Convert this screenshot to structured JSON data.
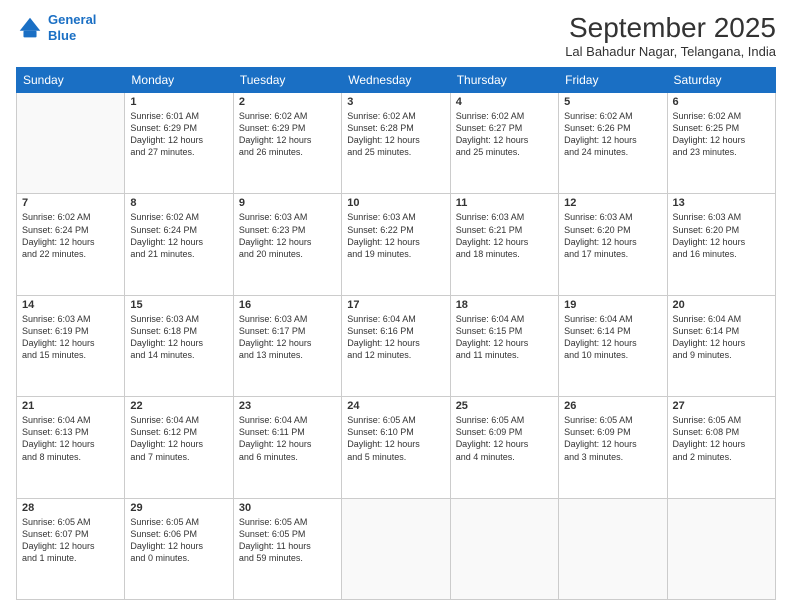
{
  "logo": {
    "line1": "General",
    "line2": "Blue"
  },
  "title": "September 2025",
  "subtitle": "Lal Bahadur Nagar, Telangana, India",
  "days_of_week": [
    "Sunday",
    "Monday",
    "Tuesday",
    "Wednesday",
    "Thursday",
    "Friday",
    "Saturday"
  ],
  "weeks": [
    [
      {
        "num": "",
        "info": ""
      },
      {
        "num": "1",
        "info": "Sunrise: 6:01 AM\nSunset: 6:29 PM\nDaylight: 12 hours\nand 27 minutes."
      },
      {
        "num": "2",
        "info": "Sunrise: 6:02 AM\nSunset: 6:29 PM\nDaylight: 12 hours\nand 26 minutes."
      },
      {
        "num": "3",
        "info": "Sunrise: 6:02 AM\nSunset: 6:28 PM\nDaylight: 12 hours\nand 25 minutes."
      },
      {
        "num": "4",
        "info": "Sunrise: 6:02 AM\nSunset: 6:27 PM\nDaylight: 12 hours\nand 25 minutes."
      },
      {
        "num": "5",
        "info": "Sunrise: 6:02 AM\nSunset: 6:26 PM\nDaylight: 12 hours\nand 24 minutes."
      },
      {
        "num": "6",
        "info": "Sunrise: 6:02 AM\nSunset: 6:25 PM\nDaylight: 12 hours\nand 23 minutes."
      }
    ],
    [
      {
        "num": "7",
        "info": "Sunrise: 6:02 AM\nSunset: 6:24 PM\nDaylight: 12 hours\nand 22 minutes."
      },
      {
        "num": "8",
        "info": "Sunrise: 6:02 AM\nSunset: 6:24 PM\nDaylight: 12 hours\nand 21 minutes."
      },
      {
        "num": "9",
        "info": "Sunrise: 6:03 AM\nSunset: 6:23 PM\nDaylight: 12 hours\nand 20 minutes."
      },
      {
        "num": "10",
        "info": "Sunrise: 6:03 AM\nSunset: 6:22 PM\nDaylight: 12 hours\nand 19 minutes."
      },
      {
        "num": "11",
        "info": "Sunrise: 6:03 AM\nSunset: 6:21 PM\nDaylight: 12 hours\nand 18 minutes."
      },
      {
        "num": "12",
        "info": "Sunrise: 6:03 AM\nSunset: 6:20 PM\nDaylight: 12 hours\nand 17 minutes."
      },
      {
        "num": "13",
        "info": "Sunrise: 6:03 AM\nSunset: 6:20 PM\nDaylight: 12 hours\nand 16 minutes."
      }
    ],
    [
      {
        "num": "14",
        "info": "Sunrise: 6:03 AM\nSunset: 6:19 PM\nDaylight: 12 hours\nand 15 minutes."
      },
      {
        "num": "15",
        "info": "Sunrise: 6:03 AM\nSunset: 6:18 PM\nDaylight: 12 hours\nand 14 minutes."
      },
      {
        "num": "16",
        "info": "Sunrise: 6:03 AM\nSunset: 6:17 PM\nDaylight: 12 hours\nand 13 minutes."
      },
      {
        "num": "17",
        "info": "Sunrise: 6:04 AM\nSunset: 6:16 PM\nDaylight: 12 hours\nand 12 minutes."
      },
      {
        "num": "18",
        "info": "Sunrise: 6:04 AM\nSunset: 6:15 PM\nDaylight: 12 hours\nand 11 minutes."
      },
      {
        "num": "19",
        "info": "Sunrise: 6:04 AM\nSunset: 6:14 PM\nDaylight: 12 hours\nand 10 minutes."
      },
      {
        "num": "20",
        "info": "Sunrise: 6:04 AM\nSunset: 6:14 PM\nDaylight: 12 hours\nand 9 minutes."
      }
    ],
    [
      {
        "num": "21",
        "info": "Sunrise: 6:04 AM\nSunset: 6:13 PM\nDaylight: 12 hours\nand 8 minutes."
      },
      {
        "num": "22",
        "info": "Sunrise: 6:04 AM\nSunset: 6:12 PM\nDaylight: 12 hours\nand 7 minutes."
      },
      {
        "num": "23",
        "info": "Sunrise: 6:04 AM\nSunset: 6:11 PM\nDaylight: 12 hours\nand 6 minutes."
      },
      {
        "num": "24",
        "info": "Sunrise: 6:05 AM\nSunset: 6:10 PM\nDaylight: 12 hours\nand 5 minutes."
      },
      {
        "num": "25",
        "info": "Sunrise: 6:05 AM\nSunset: 6:09 PM\nDaylight: 12 hours\nand 4 minutes."
      },
      {
        "num": "26",
        "info": "Sunrise: 6:05 AM\nSunset: 6:09 PM\nDaylight: 12 hours\nand 3 minutes."
      },
      {
        "num": "27",
        "info": "Sunrise: 6:05 AM\nSunset: 6:08 PM\nDaylight: 12 hours\nand 2 minutes."
      }
    ],
    [
      {
        "num": "28",
        "info": "Sunrise: 6:05 AM\nSunset: 6:07 PM\nDaylight: 12 hours\nand 1 minute."
      },
      {
        "num": "29",
        "info": "Sunrise: 6:05 AM\nSunset: 6:06 PM\nDaylight: 12 hours\nand 0 minutes."
      },
      {
        "num": "30",
        "info": "Sunrise: 6:05 AM\nSunset: 6:05 PM\nDaylight: 11 hours\nand 59 minutes."
      },
      {
        "num": "",
        "info": ""
      },
      {
        "num": "",
        "info": ""
      },
      {
        "num": "",
        "info": ""
      },
      {
        "num": "",
        "info": ""
      }
    ]
  ]
}
